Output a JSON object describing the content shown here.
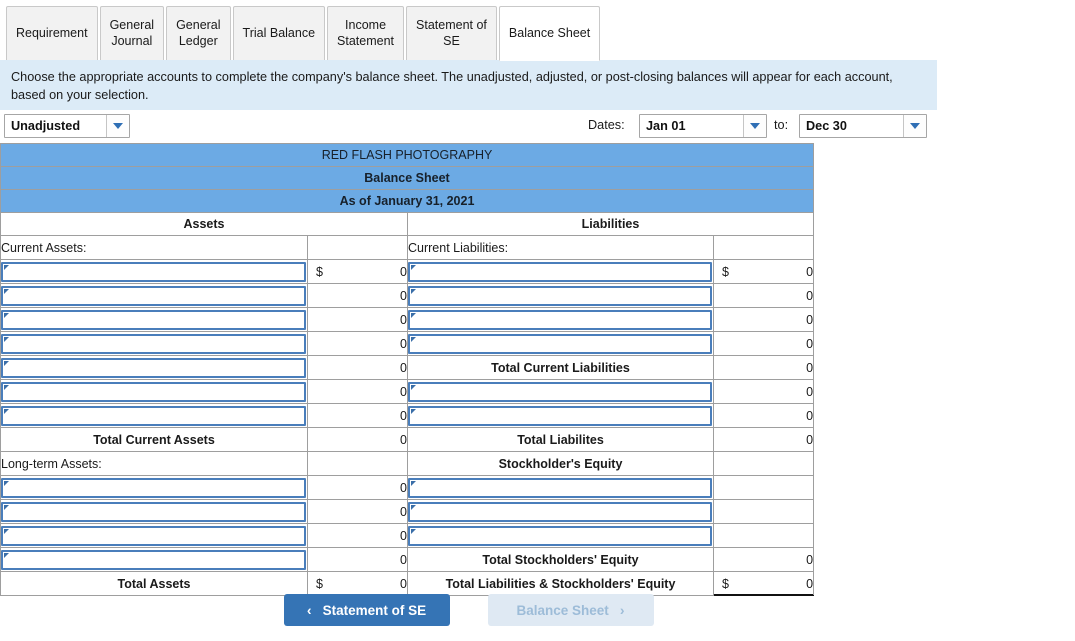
{
  "tabs": [
    {
      "label": "Requirement",
      "active": false
    },
    {
      "label": "General\nJournal",
      "active": false
    },
    {
      "label": "General\nLedger",
      "active": false
    },
    {
      "label": "Trial Balance",
      "active": false
    },
    {
      "label": "Income\nStatement",
      "active": false
    },
    {
      "label": "Statement of\nSE",
      "active": false
    },
    {
      "label": "Balance Sheet",
      "active": true
    }
  ],
  "banner": {
    "text": "Choose the appropriate accounts to complete the company's balance sheet. The unadjusted, adjusted, or post-closing balances will appear for each account, based on your selection."
  },
  "controls": {
    "status_value": "Unadjusted",
    "dates_label": "Dates:",
    "from_value": "Jan 01",
    "to_label": "to:",
    "to_value": "Dec 30"
  },
  "sheet": {
    "company": "RED FLASH PHOTOGRAPHY",
    "statement": "Balance Sheet",
    "as_of": "As of January 31, 2021",
    "assets_header": "Assets",
    "liabilities_header": "Liabilities",
    "current_assets_label": "Current Assets:",
    "current_liabilities_label": "Current Liabilities:",
    "longterm_assets_label": "Long-term Assets:",
    "equity_header": "Stockholder's Equity",
    "total_current_assets_label": "Total Current Assets",
    "total_current_assets_value": "0",
    "total_assets_label": "Total Assets",
    "total_assets_value": "0",
    "total_assets_dollar": "$",
    "total_current_liabilities_label": "Total Current Liabilities",
    "total_current_liabilities_value": "0",
    "total_liabilities_label": "Total Liabilites",
    "total_liabilities_value": "0",
    "total_equity_label": "Total Stockholders' Equity",
    "total_equity_value": "0",
    "total_liab_equity_label": "Total Liabilities & Stockholders' Equity",
    "total_liab_equity_value": "0",
    "total_liab_equity_dollar": "$",
    "dollar_sign": "$",
    "current_assets_rows": [
      {
        "account": "",
        "dollar": "$",
        "amount": "0"
      },
      {
        "account": "",
        "dollar": "",
        "amount": "0"
      },
      {
        "account": "",
        "dollar": "",
        "amount": "0"
      },
      {
        "account": "",
        "dollar": "",
        "amount": "0"
      },
      {
        "account": "",
        "dollar": "",
        "amount": "0"
      },
      {
        "account": "",
        "dollar": "",
        "amount": "0"
      },
      {
        "account": "",
        "dollar": "",
        "amount": "0"
      }
    ],
    "current_liabilities_rows": [
      {
        "account": "",
        "dollar": "$",
        "amount": "0"
      },
      {
        "account": "",
        "dollar": "",
        "amount": "0"
      },
      {
        "account": "",
        "dollar": "",
        "amount": "0"
      },
      {
        "account": "",
        "dollar": "",
        "amount": "0"
      }
    ],
    "longterm_liabilities_rows": [
      {
        "account": "",
        "dollar": "",
        "amount": "0"
      },
      {
        "account": "",
        "dollar": "",
        "amount": "0"
      }
    ],
    "longterm_assets_rows": [
      {
        "account": "",
        "dollar": "",
        "amount": "0"
      },
      {
        "account": "",
        "dollar": "",
        "amount": "0"
      },
      {
        "account": "",
        "dollar": "",
        "amount": "0"
      },
      {
        "account": "",
        "dollar": "",
        "amount": "0"
      }
    ],
    "equity_rows": [
      {
        "account": "",
        "dollar": "",
        "amount": ""
      },
      {
        "account": "",
        "dollar": "",
        "amount": ""
      },
      {
        "account": "",
        "dollar": "",
        "amount": ""
      }
    ]
  },
  "nav": {
    "prev_label": "Statement of SE",
    "prev_chevron": "‹",
    "next_label": "Balance Sheet",
    "next_chevron": "›"
  },
  "colors": {
    "band_blue": "#6caae4",
    "banner_blue": "#dcebf7",
    "picker_border": "#4a7ebb",
    "prev_button": "#3574b5",
    "next_button": "#dfe9f3"
  }
}
